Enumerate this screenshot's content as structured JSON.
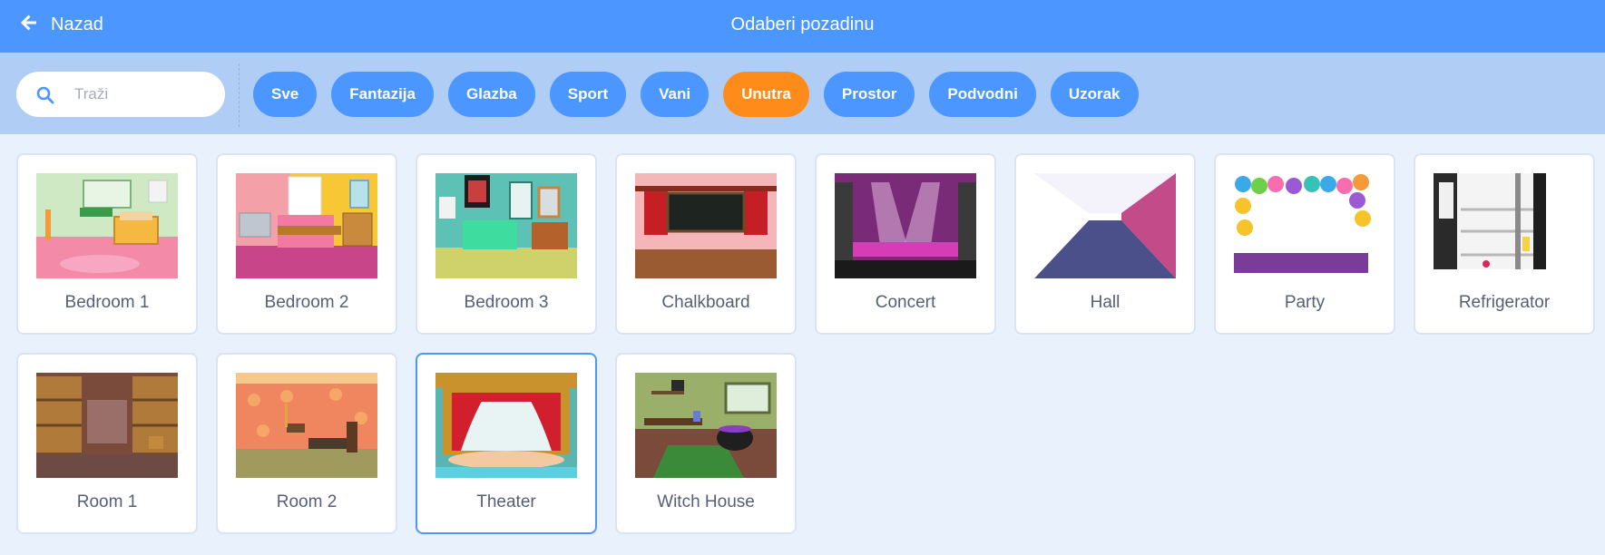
{
  "header": {
    "back_label": "Nazad",
    "title": "Odaberi pozadinu"
  },
  "search": {
    "placeholder": "Traži",
    "value": ""
  },
  "tags": [
    {
      "label": "Sve",
      "active": false
    },
    {
      "label": "Fantazija",
      "active": false
    },
    {
      "label": "Glazba",
      "active": false
    },
    {
      "label": "Sport",
      "active": false
    },
    {
      "label": "Vani",
      "active": false
    },
    {
      "label": "Unutra",
      "active": true
    },
    {
      "label": "Prostor",
      "active": false
    },
    {
      "label": "Podvodni",
      "active": false
    },
    {
      "label": "Uzorak",
      "active": false
    }
  ],
  "backdrops": [
    {
      "label": "Bedroom 1",
      "thumb": "bedroom1",
      "selected": false
    },
    {
      "label": "Bedroom 2",
      "thumb": "bedroom2",
      "selected": false
    },
    {
      "label": "Bedroom 3",
      "thumb": "bedroom3",
      "selected": false
    },
    {
      "label": "Chalkboard",
      "thumb": "chalkboard",
      "selected": false
    },
    {
      "label": "Concert",
      "thumb": "concert",
      "selected": false
    },
    {
      "label": "Hall",
      "thumb": "hall",
      "selected": false
    },
    {
      "label": "Party",
      "thumb": "party",
      "selected": false
    },
    {
      "label": "Refrigerator",
      "thumb": "refrigerator",
      "selected": false
    },
    {
      "label": "Room 1",
      "thumb": "room1",
      "selected": false
    },
    {
      "label": "Room 2",
      "thumb": "room2",
      "selected": false
    },
    {
      "label": "Theater",
      "thumb": "theater",
      "selected": true
    },
    {
      "label": "Witch House",
      "thumb": "witchhouse",
      "selected": false
    }
  ],
  "colors": {
    "primary": "#4c97ff",
    "active_tag": "#ff8c1a",
    "filter_bar": "#b0cdf5",
    "background": "#e9f1fc",
    "text": "#575e75"
  }
}
